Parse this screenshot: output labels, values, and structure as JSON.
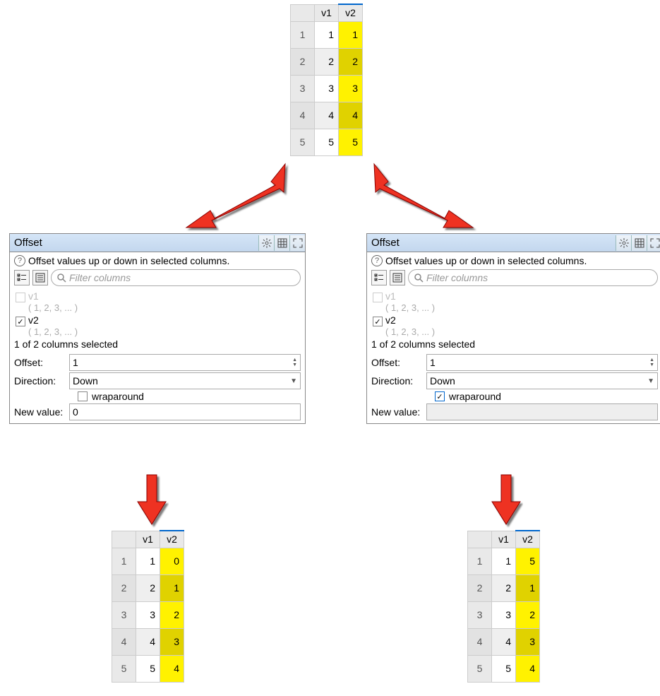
{
  "tables": {
    "top": {
      "headers": [
        "v1",
        "v2"
      ],
      "selectedCol": 1,
      "rows": [
        {
          "n": "1",
          "v1": "1",
          "v2": "1"
        },
        {
          "n": "2",
          "v1": "2",
          "v2": "2"
        },
        {
          "n": "3",
          "v1": "3",
          "v2": "3"
        },
        {
          "n": "4",
          "v1": "4",
          "v2": "4"
        },
        {
          "n": "5",
          "v1": "5",
          "v2": "5"
        }
      ]
    },
    "bottom_left": {
      "headers": [
        "v1",
        "v2"
      ],
      "selectedCol": 1,
      "rows": [
        {
          "n": "1",
          "v1": "1",
          "v2": "0"
        },
        {
          "n": "2",
          "v1": "2",
          "v2": "1"
        },
        {
          "n": "3",
          "v1": "3",
          "v2": "2"
        },
        {
          "n": "4",
          "v1": "4",
          "v2": "3"
        },
        {
          "n": "5",
          "v1": "5",
          "v2": "4"
        }
      ]
    },
    "bottom_right": {
      "headers": [
        "v1",
        "v2"
      ],
      "selectedCol": 1,
      "rows": [
        {
          "n": "1",
          "v1": "1",
          "v2": "5"
        },
        {
          "n": "2",
          "v1": "2",
          "v2": "1"
        },
        {
          "n": "3",
          "v1": "3",
          "v2": "2"
        },
        {
          "n": "4",
          "v1": "4",
          "v2": "3"
        },
        {
          "n": "5",
          "v1": "5",
          "v2": "4"
        }
      ]
    }
  },
  "panels": {
    "left": {
      "title": "Offset",
      "description": "Offset values up or down in selected columns.",
      "filter_placeholder": "Filter columns",
      "columns": [
        {
          "name": "v1",
          "preview": "( 1, 2, 3, ... )",
          "checked": false,
          "enabled": false
        },
        {
          "name": "v2",
          "preview": "( 1, 2, 3, ... )",
          "checked": true,
          "enabled": true
        }
      ],
      "summary": "1 of 2 columns selected",
      "offset_label": "Offset:",
      "offset": "1",
      "direction_label": "Direction:",
      "direction": "Down",
      "wraparound_label": "wraparound",
      "wraparound": false,
      "newvalue_label": "New value:",
      "newvalue": "0",
      "newvalue_enabled": true
    },
    "right": {
      "title": "Offset",
      "description": "Offset values up or down in selected columns.",
      "filter_placeholder": "Filter columns",
      "columns": [
        {
          "name": "v1",
          "preview": "( 1, 2, 3, ... )",
          "checked": false,
          "enabled": false
        },
        {
          "name": "v2",
          "preview": "( 1, 2, 3, ... )",
          "checked": true,
          "enabled": true
        }
      ],
      "summary": "1 of 2 columns selected",
      "offset_label": "Offset:",
      "offset": "1",
      "direction_label": "Direction:",
      "direction": "Down",
      "wraparound_label": "wraparound",
      "wraparound": true,
      "newvalue_label": "New value:",
      "newvalue": "",
      "newvalue_enabled": false
    }
  }
}
